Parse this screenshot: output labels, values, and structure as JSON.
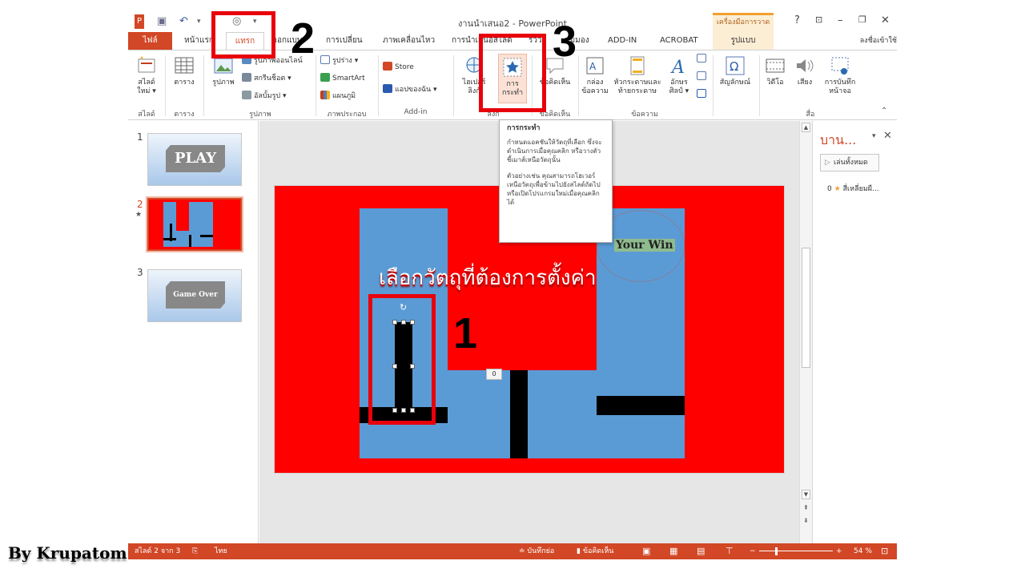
{
  "window": {
    "title": "งานนำเสนอ2 - PowerPoint",
    "contextual_group": "เครื่องมือการวาด",
    "sign_in": "ลงชื่อเข้าใช้",
    "help": "?",
    "minimize": "–",
    "restore": "❐",
    "close": "✕"
  },
  "tabs": {
    "file": "ไฟล์",
    "home": "หน้าแรก",
    "insert": "แทรก",
    "design": "ออกแบบ",
    "transitions": "การเปลี่ยน",
    "animations": "ภาพเคลื่อนไหว",
    "slideshow": "การนำเสนอสไลด์",
    "review": "รีวิว",
    "view": "มุมมอง",
    "addin": "ADD-IN",
    "acrobat": "ACROBAT",
    "format": "รูปแบบ"
  },
  "ribbon": {
    "new_slide": "สไลด์\nใหม่ ▾",
    "table": "ตาราง",
    "pictures": "รูปภาพ",
    "online_pictures": "รูปภาพออนไลน์",
    "screenshot": "สกรีนช็อต ▾",
    "photo_album": "อัลบั้มรูป ▾",
    "shapes": "รูปร่าง ▾",
    "smartart": "SmartArt",
    "chart": "แผนภูมิ",
    "store": "Store",
    "my_addins": "แอปของฉัน ▾",
    "hyperlink": "ไฮเปอร์ลิงก์",
    "action": "การ\nกระทำ",
    "comment": "ข้อคิดเห็น",
    "textbox": "กล่อง\nข้อความ",
    "header_footer": "หัวกระดาษและ\nท้ายกระดาษ",
    "wordart": "อักษร\nศิลป์ ▾",
    "symbols": "สัญลักษณ์",
    "video": "วิดีโอ",
    "audio": "เสียง",
    "screen_recording": "การบันทึก\nหน้าจอ",
    "groups": {
      "slides": "สไลด์",
      "tables": "ตาราง",
      "images": "รูปภาพ",
      "illustrations": "ภาพประกอบ",
      "addins": "Add-in",
      "links": "ลิงก์",
      "comments": "ข้อคิดเห็น",
      "text": "ข้อความ",
      "media": "สื่อ"
    }
  },
  "thumbnails": [
    {
      "number": "1",
      "label": "PLAY"
    },
    {
      "number": "2",
      "label": ""
    },
    {
      "number": "3",
      "label": "Game Over"
    }
  ],
  "slide": {
    "caption": "เลือกวัตถุที่ต้องการตั้งค่า",
    "win_text": "Your Win",
    "counter": "0"
  },
  "tooltip": {
    "title": "การกระทำ",
    "para1": "กำหนดแอคชันให้วัตถุที่เลือก ซึ่งจะดำเนินการเมื่อคุณคลิก หรือวางตัวชี้เมาส์เหนือวัตถุนั้น",
    "para2": "ตัวอย่างเช่น คุณสามารถโฮเวอร์เหนือวัตถุเพื่อข้ามไปยังสไลด์ถัดไป หรือเปิดโปรแกรมใหม่เมื่อคุณคลิกได้"
  },
  "animation_pane": {
    "title": "บาน...",
    "play_all": "เล่นทั้งหมด",
    "item_number": "0",
    "item_label": "สี่เหลี่ยมผื..."
  },
  "status": {
    "slide_of": "สไลด์ 2 จาก 3",
    "language": "ไทย",
    "notes": "บันทึกย่อ",
    "comments": "ข้อคิดเห็น",
    "zoom": "54 %"
  },
  "annotations": {
    "step1": "1",
    "step2": "2",
    "step3": "3",
    "watermark": "By Krupatom"
  },
  "colors": {
    "accent": "#d24726",
    "slide_red": "#ff0000",
    "slide_blue": "#5b9bd5",
    "highlight": "#e8000b"
  }
}
